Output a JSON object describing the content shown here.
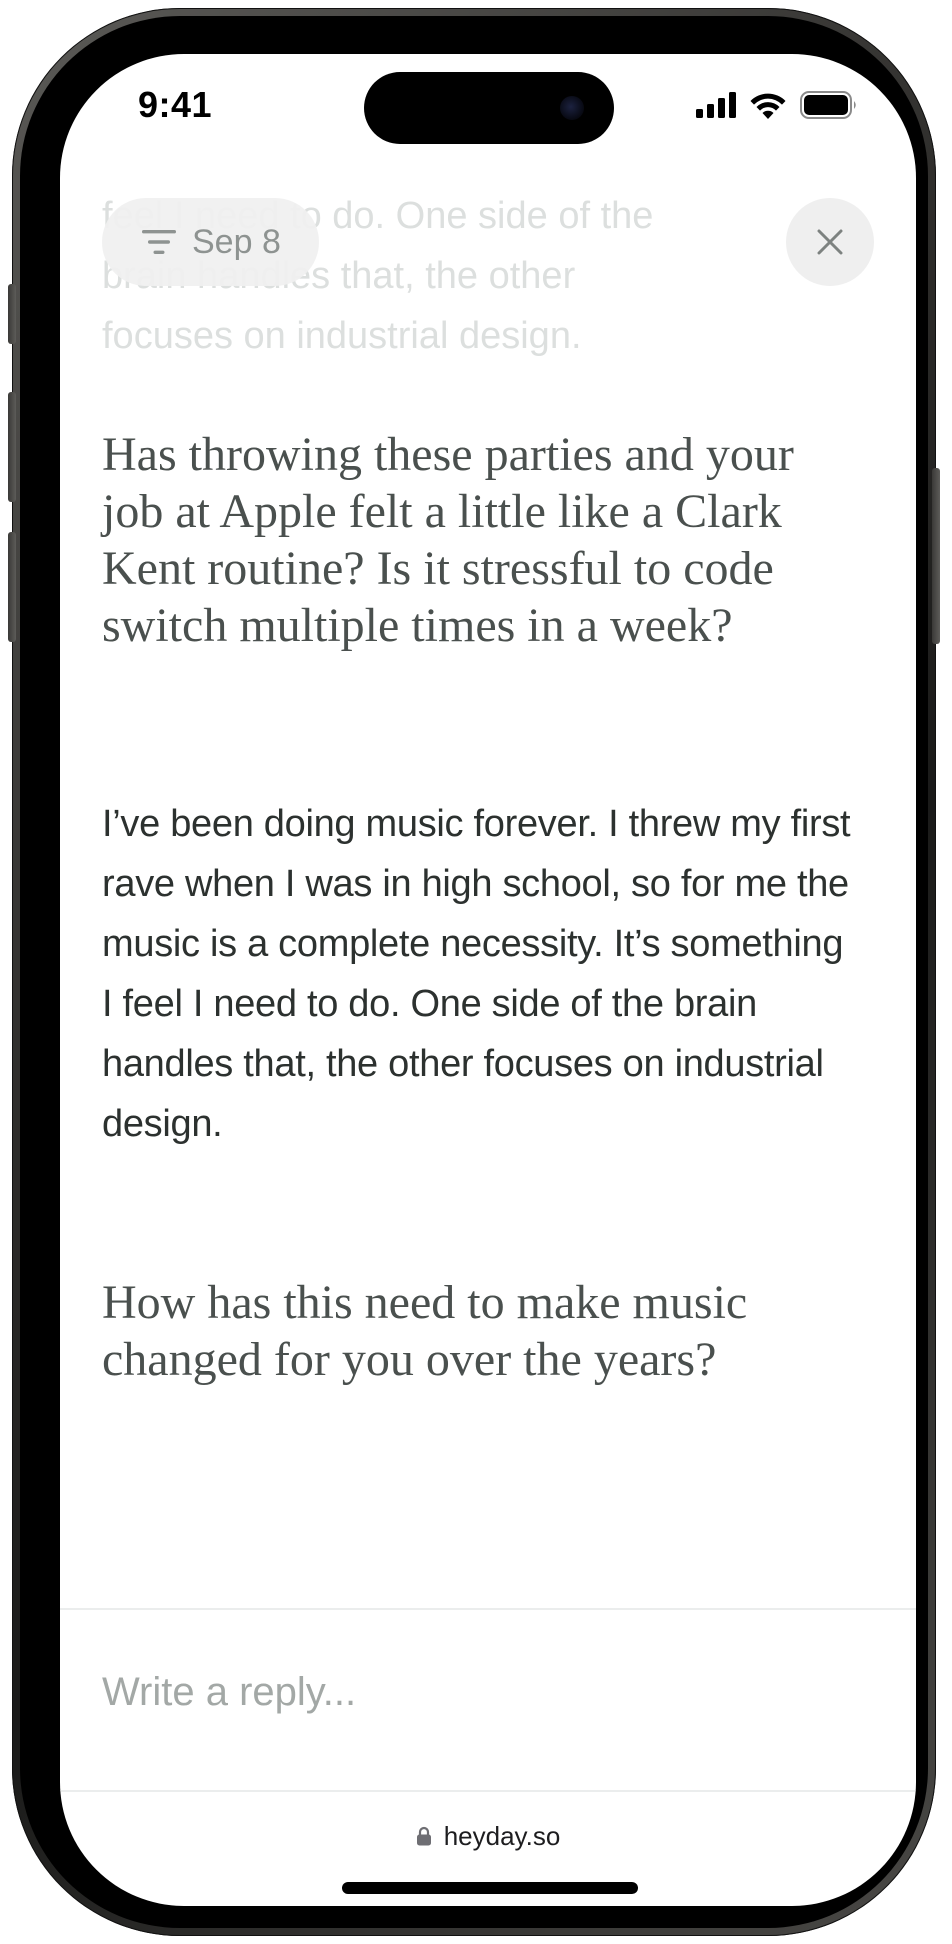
{
  "status_bar": {
    "time": "9:41",
    "icons": [
      "cellular-signal-icon",
      "wifi-icon",
      "battery-icon"
    ]
  },
  "header": {
    "filter_icon": "filter-lines-icon",
    "filter_label": "Sep 8",
    "close_icon": "close-icon"
  },
  "conversation": {
    "faded_lines": [
      "feel I need to do. One side of the",
      "brain handles that, the other",
      "focuses on industrial design."
    ],
    "question_1": "Has throwing these parties and your job at Apple felt a little like a Clark Kent routine? Is it stressful to code switch multiple times in a week?",
    "answer_1": "I’ve been doing music forever. I threw my first rave when I was in high school, so for me the music is a complete necessity. It’s something I feel I need to do. One side of the brain handles that, the other focuses on industrial design.",
    "question_2": "How has this need to make music changed for you over the years?"
  },
  "reply": {
    "placeholder": "Write a reply...",
    "value": ""
  },
  "browser": {
    "lock_icon": "lock-icon",
    "url": "heyday.so"
  },
  "colors": {
    "question_text": "#4a504e",
    "answer_text": "#2c312f",
    "placeholder_text": "#a3a8a6",
    "chip_background": "#f0f0f0"
  }
}
